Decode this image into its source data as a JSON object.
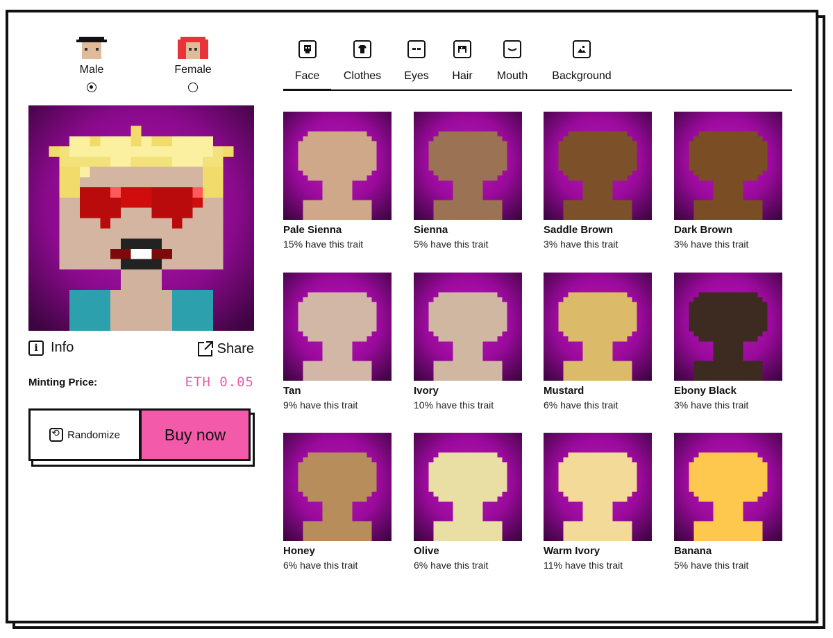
{
  "genders": [
    {
      "label": "Male",
      "selected": true
    },
    {
      "label": "Female",
      "selected": false
    }
  ],
  "preview": {
    "info_label": "Info",
    "share_label": "Share",
    "minting_label": "Minting Price:",
    "price": "ETH 0.05"
  },
  "actions": {
    "randomize_label": "Randomize",
    "buy_label": "Buy now"
  },
  "tabs": [
    {
      "label": "Face",
      "icon": "face-icon",
      "active": true
    },
    {
      "label": "Clothes",
      "icon": "shirt-icon",
      "active": false
    },
    {
      "label": "Eyes",
      "icon": "eyes-icon",
      "active": false
    },
    {
      "label": "Hair",
      "icon": "hair-icon",
      "active": false
    },
    {
      "label": "Mouth",
      "icon": "mouth-icon",
      "active": false
    },
    {
      "label": "Background",
      "icon": "image-icon",
      "active": false
    }
  ],
  "traits": [
    {
      "name": "Pale Sienna",
      "rarity": "15% have this trait",
      "color": "#cfa889"
    },
    {
      "name": "Sienna",
      "rarity": "5% have this trait",
      "color": "#9b7253"
    },
    {
      "name": "Saddle Brown",
      "rarity": "3% have this trait",
      "color": "#7c512a"
    },
    {
      "name": "Dark Brown",
      "rarity": "3% have this trait",
      "color": "#7a4d25"
    },
    {
      "name": "Tan",
      "rarity": "9% have this trait",
      "color": "#d2b6a6"
    },
    {
      "name": "Ivory",
      "rarity": "10% have this trait",
      "color": "#d0b7a1"
    },
    {
      "name": "Mustard",
      "rarity": "6% have this trait",
      "color": "#dbbb69"
    },
    {
      "name": "Ebony Black",
      "rarity": "3% have this trait",
      "color": "#3d2a20"
    },
    {
      "name": "Honey",
      "rarity": "6% have this trait",
      "color": "#b78e5b"
    },
    {
      "name": "Olive",
      "rarity": "6% have this trait",
      "color": "#e9dea3"
    },
    {
      "name": "Warm Ivory",
      "rarity": "11% have this trait",
      "color": "#f3da98"
    },
    {
      "name": "Banana",
      "rarity": "5% have this trait",
      "color": "#fec84f"
    }
  ],
  "colors": {
    "accent_pink": "#f35aaa",
    "bg_purple": "#9a0a9c",
    "bg_dark": "#3d0540"
  }
}
